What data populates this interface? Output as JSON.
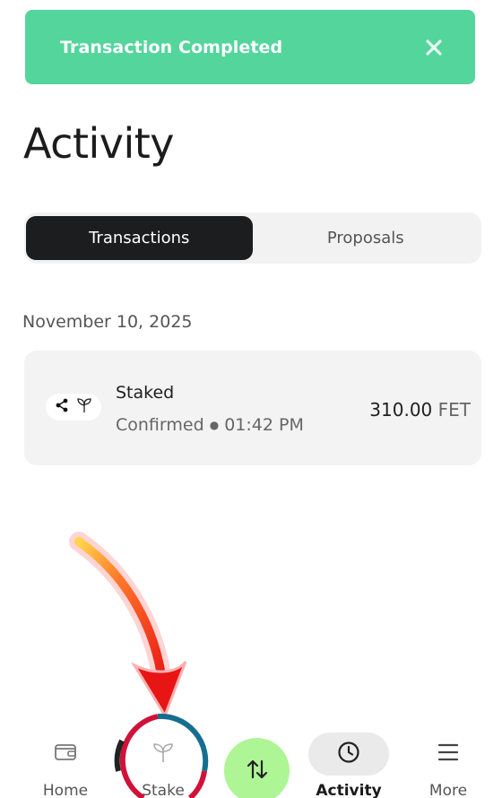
{
  "toast": {
    "message": "Transaction Completed",
    "close_icon": "close-icon"
  },
  "header": {
    "title": "Activity"
  },
  "tabs": [
    {
      "label": "Transactions",
      "active": true
    },
    {
      "label": "Proposals",
      "active": false
    }
  ],
  "transactions": {
    "date": "November 10, 2025",
    "items": [
      {
        "title": "Staked",
        "status": "Confirmed",
        "separator": "●",
        "time": "01:42 PM",
        "amount": "310.00",
        "currency": "FET",
        "icons": [
          "fetch-logo-icon",
          "sprout-icon"
        ]
      }
    ]
  },
  "bottom_nav": {
    "items": [
      {
        "label": "Home",
        "icon": "wallet-icon"
      },
      {
        "label": "Stake",
        "icon": "sprout-icon"
      },
      {
        "label": "",
        "icon": "swap-arrows-icon"
      },
      {
        "label": "Activity",
        "icon": "clock-icon",
        "active": true
      },
      {
        "label": "More",
        "icon": "menu-icon"
      }
    ]
  },
  "colors": {
    "toast_bg": "#53d59c",
    "tab_active_bg": "#1b1d1e",
    "swap_button_bg": "#aef596",
    "annotation_arrow": "#e52020",
    "annotation_ring_left": "#d0123a",
    "annotation_ring_right": "#156e8f"
  }
}
